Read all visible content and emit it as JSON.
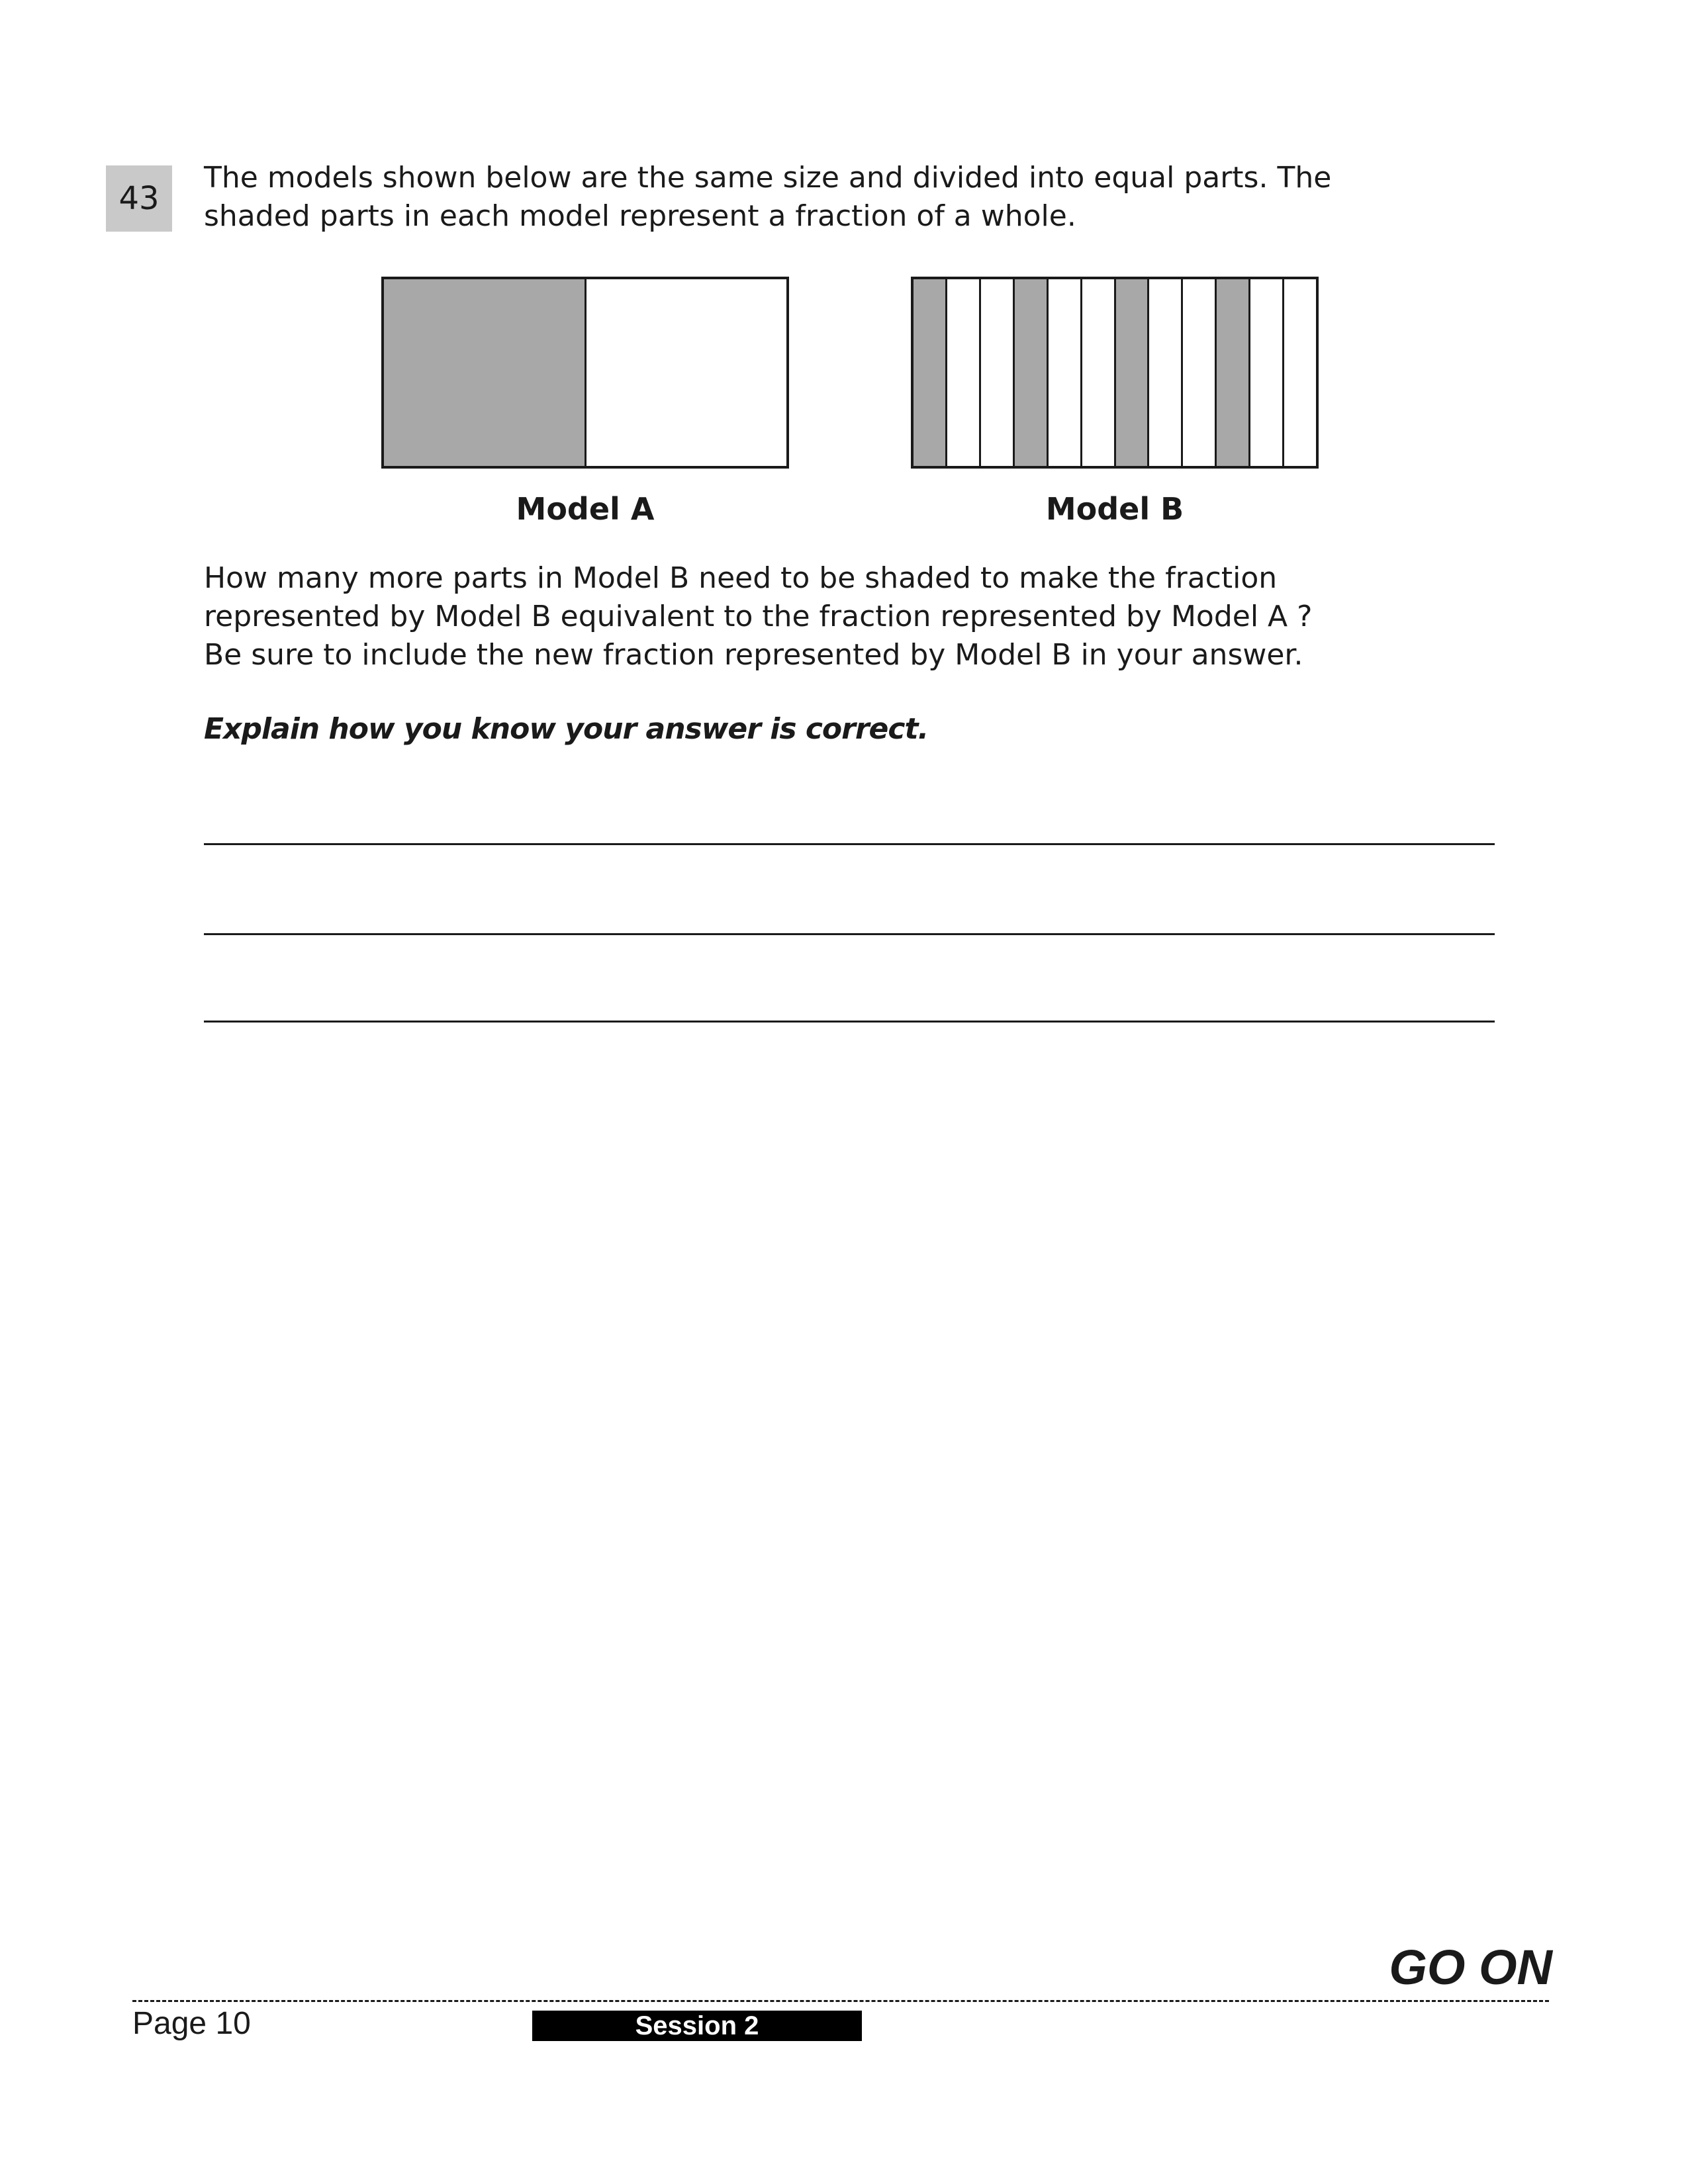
{
  "question": {
    "number": "43",
    "intro_lines": [
      "The models shown below are the same size and divided into equal parts. The",
      "shaded parts in each model represent a fraction of a whole."
    ],
    "models": [
      {
        "label": "Model A",
        "parts": 2,
        "shaded": [
          0
        ]
      },
      {
        "label": "Model B",
        "parts": 12,
        "shaded": [
          0,
          3,
          6,
          9
        ]
      }
    ],
    "prompt_lines": [
      "How many more parts in Model B need to be shaded to make the fraction",
      "represented by Model B equivalent to the fraction represented by Model A ?",
      "Be sure to include the new fraction represented by Model B in your answer."
    ],
    "instruction": "Explain how you know your answer is correct.",
    "answer_line_count": 3,
    "shade_color": "#a8a8a8"
  },
  "footer": {
    "go_on": "GO ON",
    "page": "Page 10",
    "session": "Session 2"
  }
}
